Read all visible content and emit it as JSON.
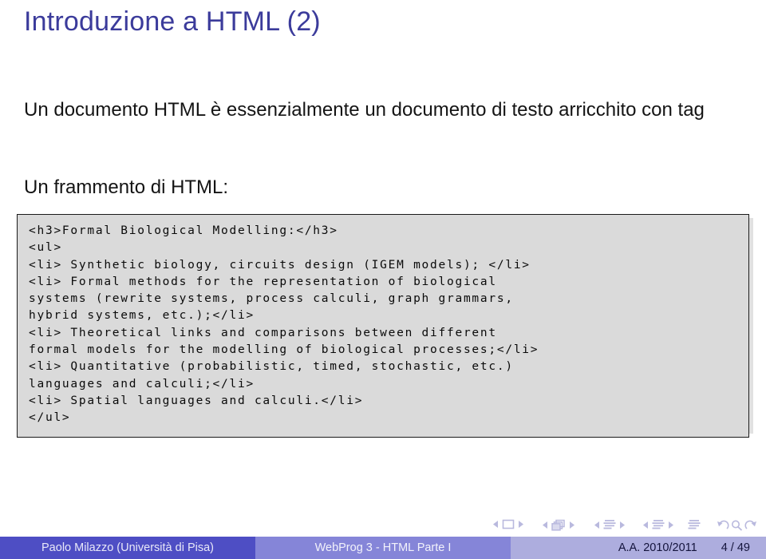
{
  "slide": {
    "title": "Introduzione a HTML (2)",
    "title_color": "#3b3b9b",
    "paragraph_1": "Un documento HTML è essenzialmente un documento di testo arricchito con tag",
    "paragraph_2": "Un frammento di HTML:"
  },
  "code_block": {
    "background_color": "#dadada",
    "border_color": "#1a1a1a",
    "lines": [
      "<h3>Formal Biological Modelling:</h3>",
      "<ul>",
      "<li> Synthetic biology, circuits design (IGEM models); </li>",
      "<li> Formal methods for the representation of biological",
      "systems (rewrite systems, process calculi, graph grammars,",
      "hybrid systems, etc.);</li>",
      "<li> Theoretical links and comparisons between different",
      "formal models for the modelling of biological processes;</li>",
      "<li> Quantitative (probabilistic, timed, stochastic, etc.)",
      "languages and calculi;</li>",
      "<li> Spatial languages and calculi.</li>",
      "</ul>"
    ]
  },
  "navigation": {
    "groups": [
      {
        "name": "slide-nav",
        "icon": "square-icon"
      },
      {
        "name": "frame-nav",
        "icon": "stacked-pages-icon"
      },
      {
        "name": "subsection-nav",
        "icon": "lines-icon"
      },
      {
        "name": "section-nav",
        "icon": "lines-icon"
      }
    ],
    "doc_icon": "lines-icon",
    "back_icon": "undo-arrow-icon",
    "search_icon": "magnifier-icon",
    "forward_icon": "redo-arrow-icon",
    "icon_color": "#b9b9de"
  },
  "footer": {
    "author": "Paolo Milazzo (Università di Pisa)",
    "subject": "WebProg 3 - HTML Parte I",
    "academic_year": "A.A. 2010/2011",
    "page": "4 / 49",
    "author_bg": "#4e4ec4",
    "subject_bg": "#8585d8",
    "meta_bg": "#adadde"
  }
}
